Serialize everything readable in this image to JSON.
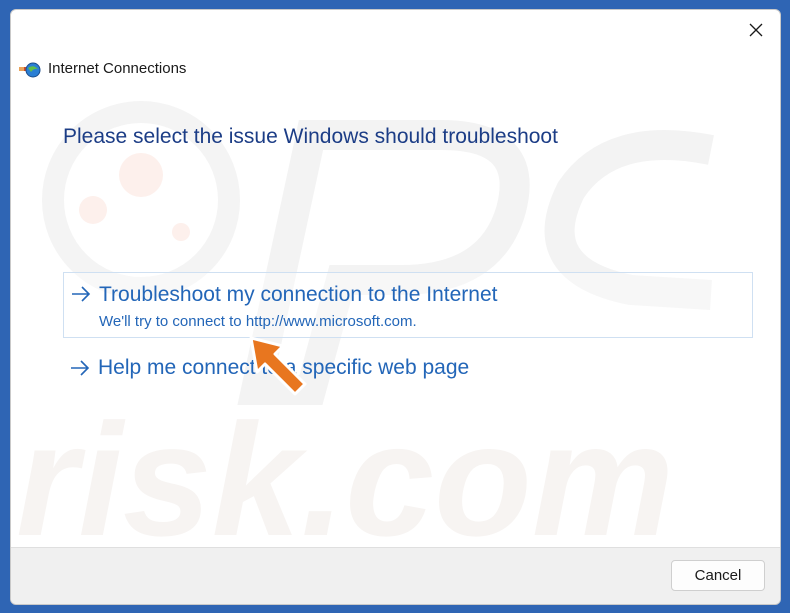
{
  "window": {
    "title": "Internet Connections",
    "app_icon": "network-globe-icon",
    "close_icon": "close-icon"
  },
  "content": {
    "heading": "Please select the issue Windows should troubleshoot",
    "options": [
      {
        "title": "Troubleshoot my connection to the Internet",
        "description": "We'll try to connect to http://www.microsoft.com.",
        "icon": "arrow-right-icon"
      },
      {
        "title": "Help me connect to a specific web page",
        "icon": "arrow-right-icon"
      }
    ]
  },
  "footer": {
    "cancel_label": "Cancel"
  },
  "watermark": {
    "text": "risk.com"
  },
  "colors": {
    "desktop": "#2f65b4",
    "heading": "#1c3d86",
    "link": "#2366b8",
    "pointer_arrow": "#e8761f"
  }
}
